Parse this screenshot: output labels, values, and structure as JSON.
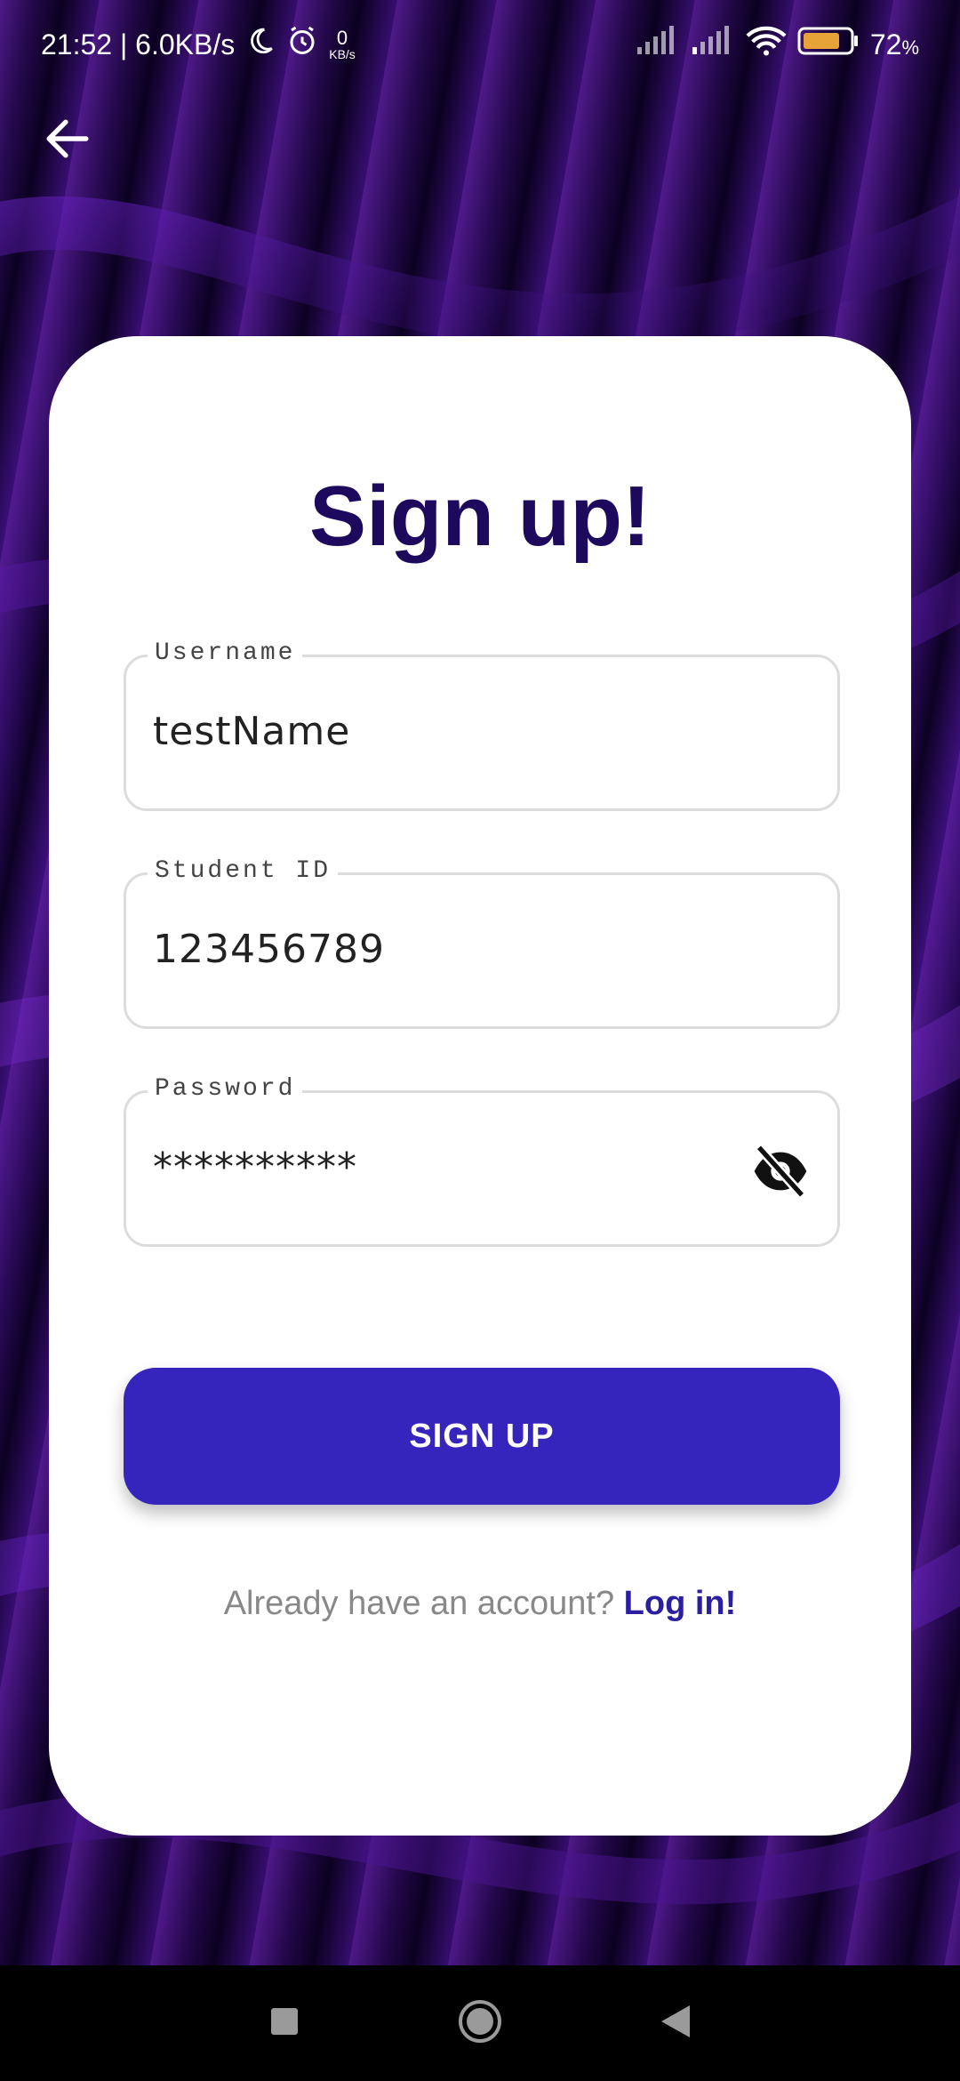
{
  "status_bar": {
    "time_speed": "21:52 | 6.0KB/s",
    "net_speed_value": "0",
    "net_speed_unit": "KB/s",
    "battery": "72",
    "battery_unit": "%",
    "icons": [
      "moon-icon",
      "alarm-icon",
      "signal-icon",
      "signal-icon",
      "wifi-icon",
      "battery-icon"
    ]
  },
  "header": {
    "back_icon": "arrow-left-icon"
  },
  "form": {
    "title": "Sign up!",
    "username": {
      "label": "Username",
      "value": "testName"
    },
    "student_id": {
      "label": "Student ID",
      "value": "123456789"
    },
    "password": {
      "label": "Password",
      "value": "**********",
      "toggle_icon": "eye-off-icon"
    },
    "submit_label": "SIGN UP",
    "login_prompt": "Already have an account?",
    "login_link": "Log in!"
  },
  "nav": {
    "icons": [
      "square-icon",
      "circle-icon",
      "triangle-back-icon"
    ]
  },
  "colors": {
    "primary": "#3525bd",
    "title": "#1d0a5c",
    "link": "#2a1fa0"
  }
}
